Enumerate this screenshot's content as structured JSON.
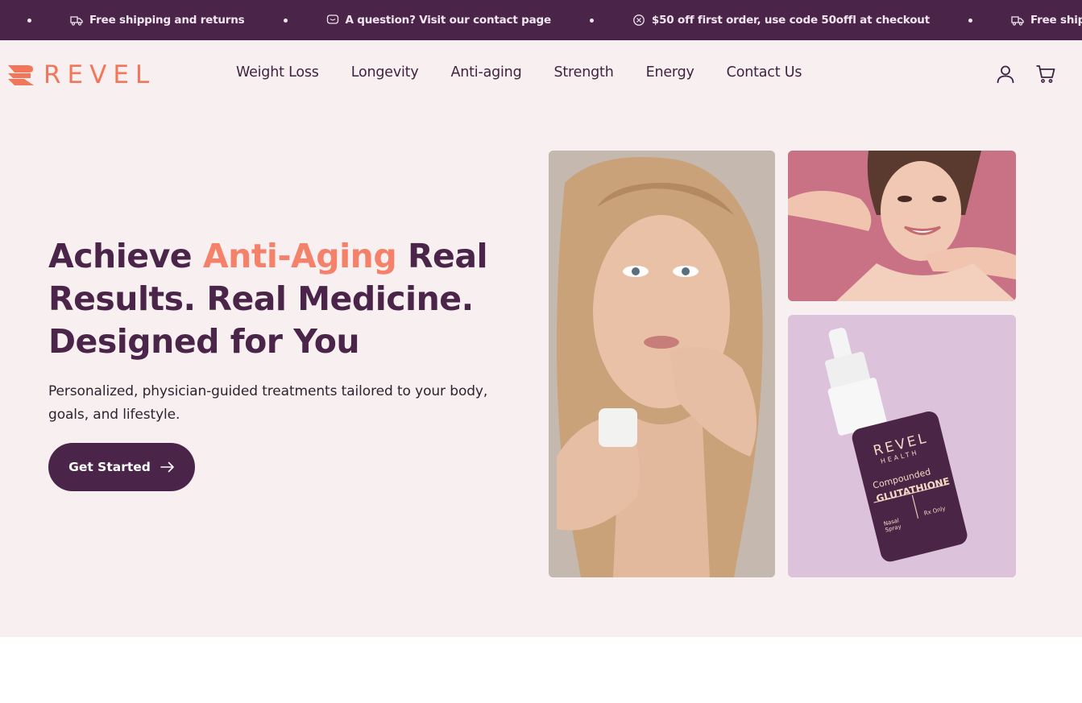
{
  "announcement_bar": {
    "items": [
      {
        "icon": "truck-icon",
        "text": "Free shipping and returns"
      },
      {
        "icon": "chat-bubble-icon",
        "text": "A question? Visit our contact page"
      },
      {
        "icon": "discount-badge-icon",
        "text": "$50 off first order, use code 50offl at checkout"
      },
      {
        "icon": "truck-icon",
        "text": "Free shipping and returns"
      }
    ]
  },
  "header": {
    "logo_text": "REVEL",
    "nav": [
      "Weight Loss",
      "Longevity",
      "Anti-aging",
      "Strength",
      "Energy",
      "Contact Us"
    ],
    "icons": [
      "user-account-icon",
      "shopping-cart-icon"
    ]
  },
  "hero": {
    "headline_part1": "Achieve ",
    "headline_accent": "Anti-Aging",
    "headline_part2": " Real Results. Real Medicine. Designed for You",
    "subtitle": "Personalized, physician-guided treatments tailored to your body, goals, and lifestyle.",
    "cta_label": "Get Started"
  },
  "product_image": {
    "brand": "REVEL",
    "brand_sub": "HEALTH",
    "line1": "Compounded",
    "line2": "GLUTATHIONE",
    "left_label": "Nasal Spray",
    "right_label": "Rx Only"
  },
  "colors": {
    "brand_purple": "#4a2549",
    "accent_coral": "#f4826b",
    "hero_background": "#f8eff0"
  }
}
